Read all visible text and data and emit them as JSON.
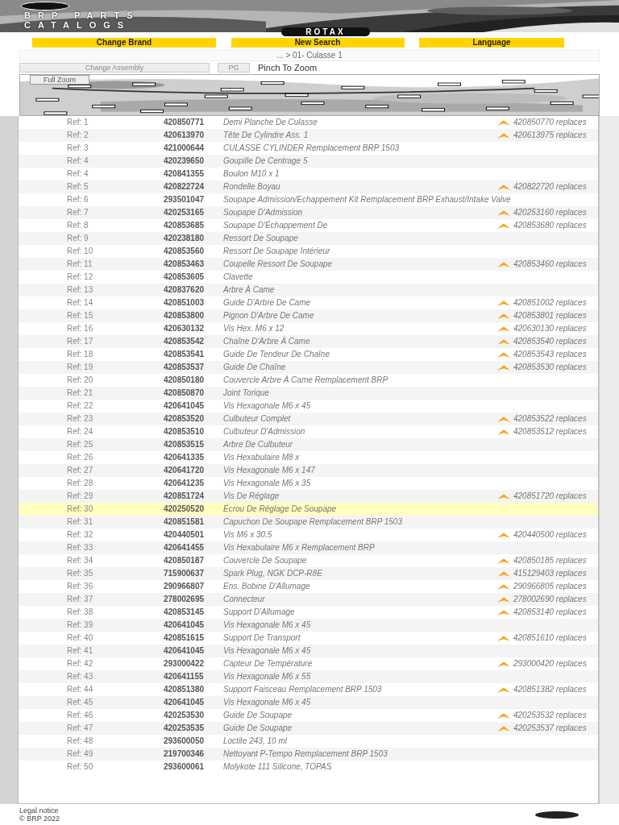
{
  "header": {
    "title_lines": [
      "BRP PARTS",
      "CATALOGS"
    ],
    "brand": "ROTAX"
  },
  "nav_buttons": [
    "Change Brand",
    "New Search",
    "Language"
  ],
  "breadcrumb": "... > 01- Culasse 1",
  "toolbar": {
    "change_button": "Change Assembly",
    "page_button": "PG",
    "hint": "Pinch To Zoom"
  },
  "diagram": {
    "zoom_button": "Full Zoom"
  },
  "parts": [
    {
      "ref": "Ref: 1",
      "number": "420850771",
      "description": "Demi Planche De Culasse",
      "replaces": "420850770 replaces",
      "selected": false
    },
    {
      "ref": "Ref: 2",
      "number": "420613970",
      "description": "Tête De Cylindre Ass. 1",
      "replaces": "420613975 replaces",
      "selected": false
    },
    {
      "ref": "Ref: 3",
      "number": "421000644",
      "description": "CULASSE CYLINDER Remplacement BRP 1503",
      "selected": false
    },
    {
      "ref": "Ref: 4",
      "number": "420239650",
      "description": "Goupille De Centrage 5",
      "selected": false
    },
    {
      "ref": "Ref: 4",
      "number": "420841355",
      "description": "Boulon M10 x 1",
      "selected": false
    },
    {
      "ref": "Ref: 5",
      "number": "420822724",
      "description": "Rondelle Boyau",
      "replaces": "420822720 replaces",
      "selected": false
    },
    {
      "ref": "Ref: 6",
      "number": "293501047",
      "description": "Soupape Admission/Echappement Kit Remplacement BRP Exhaust/Intake Valve",
      "selected": false
    },
    {
      "ref": "Ref: 7",
      "number": "420253165",
      "description": "Soupape D'Admission",
      "replaces": "420253160 replaces",
      "selected": false
    },
    {
      "ref": "Ref: 8",
      "number": "420853685",
      "description": "Soupape D'Échappement De",
      "replaces": "420853680 replaces",
      "selected": false
    },
    {
      "ref": "Ref: 9",
      "number": "420238180",
      "description": "Ressort De Soupape",
      "selected": false
    },
    {
      "ref": "Ref: 10",
      "number": "420853560",
      "description": "Ressort De Soupape Intérieur",
      "selected": false
    },
    {
      "ref": "Ref: 11",
      "number": "420853463",
      "description": "Coupelle Ressort De Soupape",
      "replaces": "420853460 replaces",
      "selected": false
    },
    {
      "ref": "Ref: 12",
      "number": "420853605",
      "description": "Clavette",
      "selected": false
    },
    {
      "ref": "Ref: 13",
      "number": "420837620",
      "description": "Arbre À Came",
      "selected": false
    },
    {
      "ref": "Ref: 14",
      "number": "420851003",
      "description": "Guide D'Arbre De Came",
      "replaces": "420851002 replaces",
      "selected": false
    },
    {
      "ref": "Ref: 15",
      "number": "420853800",
      "description": "Pignon D'Arbre De Came",
      "replaces": "420853801 replaces",
      "selected": false
    },
    {
      "ref": "Ref: 16",
      "number": "420630132",
      "description": "Vis Hex. M6 x 12",
      "replaces": "420630130 replaces",
      "selected": false
    },
    {
      "ref": "Ref: 17",
      "number": "420853542",
      "description": "Chaîne D'Arbre À Came",
      "replaces": "420853540 replaces",
      "selected": false
    },
    {
      "ref": "Ref: 18",
      "number": "420853541",
      "description": "Guide De Tendeur De Chaîne",
      "replaces": "420853543 replaces",
      "selected": false
    },
    {
      "ref": "Ref: 19",
      "number": "420853537",
      "description": "Guide De Chaîne",
      "replaces": "420853530 replaces",
      "selected": false
    },
    {
      "ref": "Ref: 20",
      "number": "420850180",
      "description": "Couvercle Arbre À Came Remplacement BRP",
      "selected": false
    },
    {
      "ref": "Ref: 21",
      "number": "420850870",
      "description": "Joint Torique",
      "selected": false
    },
    {
      "ref": "Ref: 22",
      "number": "420641045",
      "description": "Vis Hexagonale M6 x 45",
      "selected": false
    },
    {
      "ref": "Ref: 23",
      "number": "420853520",
      "description": "Culbuteur Complet",
      "replaces": "420853522 replaces",
      "selected": false
    },
    {
      "ref": "Ref: 24",
      "number": "420853510",
      "description": "Culbuteur D'Admission",
      "replaces": "420853512 replaces",
      "selected": false
    },
    {
      "ref": "Ref: 25",
      "number": "420853515",
      "description": "Arbre De Culbuteur",
      "selected": false
    },
    {
      "ref": "Ref: 26",
      "number": "420641335",
      "description": "Vis Hexabulaire M8 x",
      "selected": false
    },
    {
      "ref": "Ref: 27",
      "number": "420641720",
      "description": "Vis Hexagonale M6 x 147",
      "selected": false
    },
    {
      "ref": "Ref: 28",
      "number": "420641235",
      "description": "Vis Hexagonale M6 x 35",
      "selected": false
    },
    {
      "ref": "Ref: 29",
      "number": "420851724",
      "description": "Vis De Réglage",
      "replaces": "420851720 replaces",
      "selected": false
    },
    {
      "ref": "Ref: 30",
      "number": "420250520",
      "description": "Écrou De Réglage De Soupape",
      "selected": true
    },
    {
      "ref": "Ref: 31",
      "number": "420851581",
      "description": "Capuchon De Soupape Remplacement BRP 1503",
      "selected": false
    },
    {
      "ref": "Ref: 32",
      "number": "420440501",
      "description": "Vis M6 x 30.5",
      "replaces": "420440500 replaces",
      "selected": false
    },
    {
      "ref": "Ref: 33",
      "number": "420641455",
      "description": "Vis Hexabulaire M6 x Remplacement BRP",
      "selected": false
    },
    {
      "ref": "Ref: 34",
      "number": "420850187",
      "description": "Couvercle De Soupape",
      "replaces": "420850185 replaces",
      "selected": false
    },
    {
      "ref": "Ref: 35",
      "number": "715900637",
      "description": "Spark Plug, NGK DCP-R8E",
      "replaces": "415129403 replaces",
      "selected": false
    },
    {
      "ref": "Ref: 36",
      "number": "290966807",
      "description": "Ens. Bobine D'Allumage",
      "replaces": "290966805 replaces",
      "selected": false
    },
    {
      "ref": "Ref: 37",
      "number": "278002695",
      "description": "Connecteur",
      "replaces": "278002690 replaces",
      "selected": false
    },
    {
      "ref": "Ref: 38",
      "number": "420853145",
      "description": "Support D'Allumage",
      "replaces": "420853140 replaces",
      "selected": false
    },
    {
      "ref": "Ref: 39",
      "number": "420641045",
      "description": "Vis Hexagonale M6 x 45",
      "selected": false
    },
    {
      "ref": "Ref: 40",
      "number": "420851615",
      "description": "Support De Transport",
      "replaces": "420851610 replaces",
      "selected": false
    },
    {
      "ref": "Ref: 41",
      "number": "420641045",
      "description": "Vis Hexagonale M6 x 45",
      "selected": false
    },
    {
      "ref": "Ref: 42",
      "number": "293000422",
      "description": "Capteur De Température",
      "replaces": "293000420 replaces",
      "selected": false
    },
    {
      "ref": "Ref: 43",
      "number": "420641155",
      "description": "Vis Hexagonale M6 x 55",
      "selected": false
    },
    {
      "ref": "Ref: 44",
      "number": "420851380",
      "description": "Support Faisceau Remplacement BRP 1503",
      "replaces": "420851382 replaces",
      "selected": false
    },
    {
      "ref": "Ref: 45",
      "number": "420641045",
      "description": "Vis Hexagonale M6 x 45",
      "selected": false
    },
    {
      "ref": "Ref: 46",
      "number": "420253530",
      "description": "Guide De Soupape",
      "replaces": "420253532 replaces",
      "selected": false
    },
    {
      "ref": "Ref: 47",
      "number": "420253535",
      "description": "Guide De Soupape",
      "replaces": "420253537 replaces",
      "selected": false
    },
    {
      "ref": "Ref: 48",
      "number": "293600050",
      "description": "Loctite 243, 10 ml",
      "selected": false
    },
    {
      "ref": "Ref: 49",
      "number": "219700346",
      "description": "Nettoyant P-Tempo Remplacement BRP 1503",
      "selected": false
    },
    {
      "ref": "Ref: 50",
      "number": "293600061",
      "description": "Molykote 111 Silicone, TOPAS",
      "selected": false
    }
  ],
  "footer": {
    "lines": [
      "Legal notice",
      "© BRP 2022"
    ]
  }
}
